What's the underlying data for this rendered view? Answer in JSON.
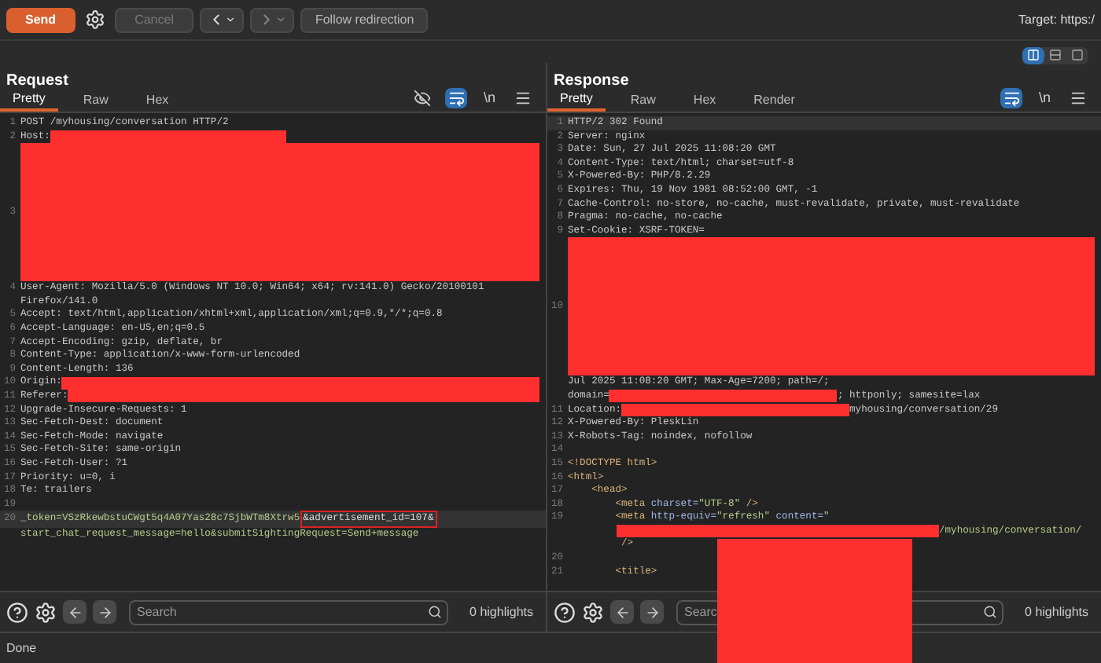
{
  "toolbar": {
    "send": "Send",
    "cancel": {
      "label": "Cancel",
      "disabled": true
    },
    "follow": "Follow redirection",
    "target": "Target: https:/"
  },
  "layout_toggles": [
    {
      "kind": "columns",
      "selected": true
    },
    {
      "kind": "rows",
      "selected": false
    },
    {
      "kind": "single",
      "selected": false
    }
  ],
  "panels": [
    {
      "title": "Request",
      "tabs": [
        {
          "label": "Pretty",
          "selected": true
        },
        {
          "label": "Raw",
          "selected": false
        },
        {
          "label": "Hex",
          "selected": false
        }
      ],
      "tools": [
        {
          "kind": "hide"
        },
        {
          "kind": "wrap",
          "selected": true
        },
        {
          "kind": "newline",
          "text": "\\n"
        },
        {
          "kind": "menu"
        }
      ],
      "lines": [
        {
          "n": "1",
          "parts": [
            {
              "kind": "text",
              "text": "POST /myhousing/conversation HTTP/2"
            }
          ]
        },
        {
          "n": "2",
          "parts": [
            {
              "kind": "text",
              "text": "Host:"
            },
            {
              "kind": "redaction_short"
            }
          ]
        },
        {
          "n": "3",
          "parts": [
            {
              "kind": "block"
            }
          ]
        },
        {
          "n": "4",
          "parts": [
            {
              "kind": "text",
              "text": "User-Agent: Mozilla/5.0 (Windows NT 10.0; Win64; x64; rv:141.0) Gecko/20100101"
            }
          ]
        },
        {
          "parts": [
            {
              "kind": "text",
              "text": "Firefox/141.0"
            }
          ]
        },
        {
          "n": "5",
          "parts": [
            {
              "kind": "text",
              "text": "Accept: text/html,application/xhtml+xml,application/xml;q=0.9,*/*;q=0.8"
            }
          ]
        },
        {
          "n": "6",
          "parts": [
            {
              "kind": "text",
              "text": "Accept-Language: en-US,en;q=0.5"
            }
          ]
        },
        {
          "n": "7",
          "parts": [
            {
              "kind": "text",
              "text": "Accept-Encoding: gzip, deflate, br"
            }
          ]
        },
        {
          "n": "8",
          "parts": [
            {
              "kind": "text",
              "text": "Content-Type: application/x-www-form-urlencoded"
            }
          ]
        },
        {
          "n": "9",
          "parts": [
            {
              "kind": "text",
              "text": "Content-Length: 136"
            }
          ]
        },
        {
          "n": "10",
          "parts": [
            {
              "kind": "text",
              "text": "Origin:"
            },
            {
              "kind": "redaction_fill"
            }
          ]
        },
        {
          "n": "11",
          "parts": [
            {
              "kind": "text",
              "text": "Referer:"
            },
            {
              "kind": "redaction_fill"
            }
          ]
        },
        {
          "n": "12",
          "parts": [
            {
              "kind": "text",
              "text": "Upgrade-Insecure-Requests: 1"
            }
          ]
        },
        {
          "n": "13",
          "parts": [
            {
              "kind": "text",
              "text": "Sec-Fetch-Dest: document"
            }
          ]
        },
        {
          "n": "14",
          "parts": [
            {
              "kind": "text",
              "text": "Sec-Fetch-Mode: navigate"
            }
          ]
        },
        {
          "n": "15",
          "parts": [
            {
              "kind": "text",
              "text": "Sec-Fetch-Site: same-origin"
            }
          ]
        },
        {
          "n": "16",
          "parts": [
            {
              "kind": "text",
              "text": "Sec-Fetch-User: ?1"
            }
          ]
        },
        {
          "n": "17",
          "parts": [
            {
              "kind": "text",
              "text": "Priority: u=0, i"
            }
          ]
        },
        {
          "n": "18",
          "parts": [
            {
              "kind": "text",
              "text": "Te: trailers"
            }
          ]
        },
        {
          "n": "19"
        },
        {
          "n": "20",
          "current": true,
          "parts": [
            {
              "kind": "param",
              "text": "_token=VSzRkewbstuCWgt5q4A07Yas28c7SjbWTm8Xtrw5"
            },
            {
              "kind": "highlight",
              "text": "&advertisement_id=107&"
            }
          ]
        },
        {
          "parts": [
            {
              "kind": "param",
              "text": "start_chat_request_message=hello&submitSightingRequest=Send+message"
            }
          ]
        }
      ],
      "search": {
        "placeholder": "Search"
      },
      "highlights": "0 highlights"
    },
    {
      "title": "Response",
      "tabs": [
        {
          "label": "Pretty",
          "selected": true
        },
        {
          "label": "Raw",
          "selected": false
        },
        {
          "label": "Hex",
          "selected": false
        },
        {
          "label": "Render",
          "selected": false
        }
      ],
      "tools": [
        {
          "kind": "wrap",
          "selected": true
        },
        {
          "kind": "newline",
          "text": "\\n"
        },
        {
          "kind": "menu"
        }
      ],
      "lines": [
        {
          "n": "1",
          "current": true,
          "parts": [
            {
              "kind": "text",
              "text": "HTTP/2 302 Found"
            }
          ]
        },
        {
          "n": "2",
          "parts": [
            {
              "kind": "text",
              "text": "Server: nginx"
            }
          ]
        },
        {
          "n": "3",
          "parts": [
            {
              "kind": "text",
              "text": "Date: Sun, 27 Jul 2025 11:08:20 GMT"
            }
          ]
        },
        {
          "n": "4",
          "parts": [
            {
              "kind": "text",
              "text": "Content-Type: text/html; charset=utf-8"
            }
          ]
        },
        {
          "n": "5",
          "parts": [
            {
              "kind": "text",
              "text": "X-Powered-By: PHP/8.2.29"
            }
          ]
        },
        {
          "n": "6",
          "parts": [
            {
              "kind": "text",
              "text": "Expires: Thu, 19 Nov 1981 08:52:00 GMT, -1"
            }
          ]
        },
        {
          "n": "7",
          "parts": [
            {
              "kind": "text",
              "text": "Cache-Control: no-store, no-cache, must-revalidate, private, must-revalidate"
            }
          ]
        },
        {
          "n": "8",
          "parts": [
            {
              "kind": "text",
              "text": "Pragma: no-cache, no-cache"
            }
          ]
        },
        {
          "n": "9",
          "parts": [
            {
              "kind": "text",
              "text": "Set-Cookie: XSRF-TOKEN="
            }
          ]
        },
        {
          "n": "10",
          "parts": [
            {
              "kind": "block"
            }
          ]
        },
        {
          "parts": [
            {
              "kind": "text",
              "text": "Jul 2025 11:08:20 GMT; Max-Age=7200; path=/;"
            }
          ]
        },
        {
          "parts": [
            {
              "kind": "text",
              "text": "domain="
            },
            {
              "kind": "redaction_medium"
            },
            {
              "kind": "text",
              "text": "; httponly; samesite=lax"
            }
          ]
        },
        {
          "n": "11",
          "parts": [
            {
              "kind": "text",
              "text": "Location:"
            },
            {
              "kind": "redaction_medium"
            },
            {
              "kind": "text",
              "text": "myhousing/conversation/29"
            }
          ]
        },
        {
          "n": "12",
          "parts": [
            {
              "kind": "text",
              "text": "X-Powered-By: PleskLin"
            }
          ]
        },
        {
          "n": "13",
          "parts": [
            {
              "kind": "text",
              "text": "X-Robots-Tag: noindex, nofollow"
            }
          ]
        },
        {
          "n": "14"
        },
        {
          "n": "15",
          "parts": [
            {
              "kind": "tag",
              "text": "<!DOCTYPE html>"
            }
          ]
        },
        {
          "n": "16",
          "parts": [
            {
              "kind": "tag",
              "text": "<html>"
            }
          ]
        },
        {
          "n": "17",
          "parts": [
            {
              "kind": "tag",
              "text": "    <head>"
            }
          ]
        },
        {
          "n": "18",
          "parts": [
            {
              "kind": "tag",
              "text": "        <meta "
            },
            {
              "kind": "attr",
              "text": "charset="
            },
            {
              "kind": "value",
              "text": "\"UTF-8\""
            },
            {
              "kind": "tag",
              "text": " />"
            }
          ]
        },
        {
          "n": "19",
          "parts": [
            {
              "kind": "tag",
              "text": "        <meta "
            },
            {
              "kind": "attr",
              "text": "http-equiv="
            },
            {
              "kind": "value",
              "text": "\"refresh\""
            },
            {
              "kind": "attr",
              "text": " content="
            },
            {
              "kind": "value",
              "text": "\""
            }
          ]
        },
        {
          "parts": [
            {
              "kind": "redaction_indented"
            },
            {
              "kind": "value",
              "text": "/myhousing/conversation/"
            }
          ]
        },
        {
          "parts": [
            {
              "kind": "tag",
              "text": "         />"
            }
          ]
        },
        {
          "n": "20"
        },
        {
          "n": "21",
          "parts": [
            {
              "kind": "tag",
              "text": "        <title>"
            }
          ]
        }
      ],
      "search": {
        "placeholder": "Searc"
      },
      "highlights": "0 highlights",
      "overlay_redaction": true
    }
  ],
  "status": "Done"
}
